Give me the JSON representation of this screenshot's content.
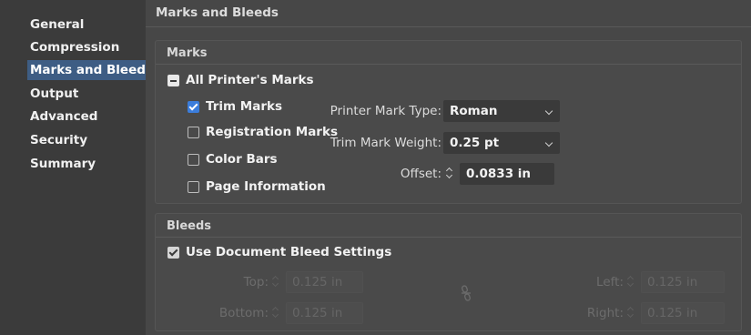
{
  "sidebar": {
    "items": [
      {
        "label": "General",
        "selected": false
      },
      {
        "label": "Compression",
        "selected": false
      },
      {
        "label": "Marks and Bleeds",
        "selected": true
      },
      {
        "label": "Output",
        "selected": false
      },
      {
        "label": "Advanced",
        "selected": false
      },
      {
        "label": "Security",
        "selected": false
      },
      {
        "label": "Summary",
        "selected": false
      }
    ]
  },
  "panel": {
    "title": "Marks and Bleeds"
  },
  "marks": {
    "title": "Marks",
    "all_printers_marks": {
      "label": "All Printer's Marks",
      "state": "mixed"
    },
    "trim_marks": {
      "label": "Trim Marks",
      "checked": true
    },
    "registration_marks": {
      "label": "Registration Marks",
      "checked": false
    },
    "color_bars": {
      "label": "Color Bars",
      "checked": false
    },
    "page_information": {
      "label": "Page Information",
      "checked": false
    },
    "printer_mark_type": {
      "label": "Printer Mark Type:",
      "value": "Roman"
    },
    "trim_mark_weight": {
      "label": "Trim Mark Weight:",
      "value": "0.25 pt"
    },
    "offset": {
      "label": "Offset:",
      "value": "0.0833 in"
    }
  },
  "bleeds": {
    "title": "Bleeds",
    "use_document_bleed": {
      "label": "Use Document Bleed Settings",
      "checked": true
    },
    "top": {
      "label": "Top:",
      "value": "0.125 in"
    },
    "bottom": {
      "label": "Bottom:",
      "value": "0.125 in"
    },
    "left": {
      "label": "Left:",
      "value": "0.125 in"
    },
    "right": {
      "label": "Right:",
      "value": "0.125 in"
    },
    "link_icon": "chain-link-icon"
  },
  "colors": {
    "selection": "#3e5d84",
    "checkbox_accent": "#3b7ddb"
  }
}
